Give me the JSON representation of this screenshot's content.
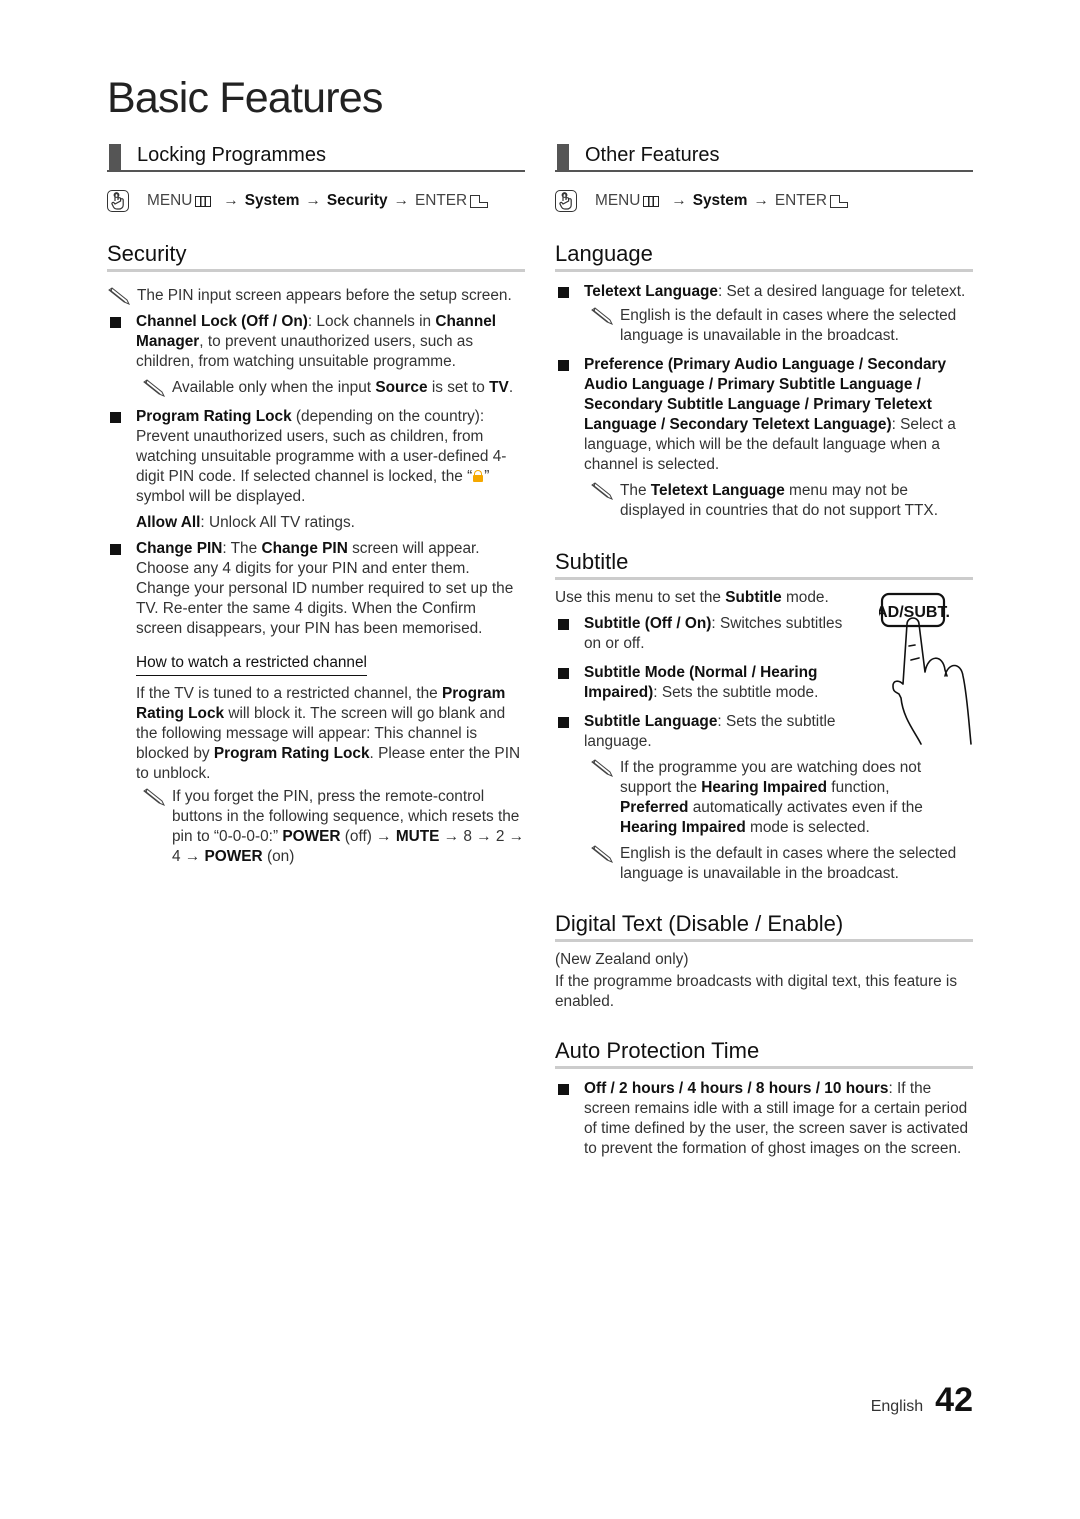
{
  "page_title": "Basic Features",
  "left": {
    "section_title": "Locking Programmes",
    "menu_path": {
      "icon": "menu-hand-icon",
      "menu": "MENU",
      "menu_glyph": "menu-grid-icon",
      "arrow": "→",
      "steps": [
        "System",
        "Security"
      ],
      "enter": "ENTER",
      "enter_glyph": "enter-icon"
    },
    "security": {
      "heading": "Security",
      "intro_note": "The PIN input screen appears before the setup screen.",
      "items": [
        {
          "label": "Channel Lock (Off / On)",
          "text_a": ": Lock channels in ",
          "bold_b": "Channel Manager",
          "text_b": ", to prevent unauthorized users, such as children, from watching unsuitable programme.",
          "note_a": "Available only when the input ",
          "note_bold_a": "Source",
          "note_b": " is set to ",
          "note_bold_b": "TV",
          "note_c": "."
        },
        {
          "label": "Program Rating Lock",
          "text_a": " (depending on the country): Prevent unauthorized users, such as children, from watching unsuitable programme with a user-defined 4-digit PIN code. If selected channel is locked, the “",
          "lock_icon": "lock-icon",
          "text_b": "” symbol will be displayed.",
          "sub_label": "Allow All",
          "sub_text": ": Unlock All TV ratings."
        },
        {
          "label": "Change PIN",
          "text_a": ": The ",
          "bold_b": "Change PIN",
          "text_b": " screen will appear. Choose any 4 digits for your PIN and enter them. Change your personal ID number required to set up the TV. Re-enter the same 4 digits. When the Confirm screen disappears, your PIN has been memorised."
        }
      ],
      "restricted": {
        "heading": "How to watch a restricted channel",
        "p1": "If the TV is tuned to a restricted channel, the ",
        "b1": "Program Rating Lock",
        "p2": " will block it. The screen will go blank and the following message will appear: This channel is blocked by ",
        "b2": "Program Rating Lock",
        "p3": ". Please enter the PIN to unblock.",
        "note_a": "If you forget the PIN, press the remote-control buttons in the following sequence, which resets the pin to “0-0-0-0:” ",
        "note_b1": "POWER",
        "note_b": " (off) → ",
        "note_b2": "MUTE",
        "note_c": " → 8 → 2 → 4 → ",
        "note_b3": "POWER",
        "note_d": " (on)"
      }
    }
  },
  "right": {
    "section_title": "Other Features",
    "menu_path": {
      "icon": "menu-hand-icon",
      "menu": "MENU",
      "arrow": "→",
      "steps": [
        "System"
      ],
      "enter": "ENTER"
    },
    "language": {
      "heading": "Language",
      "items": [
        {
          "label": "Teletext Language",
          "text": ": Set a desired language for teletext.",
          "note": "English is the default in cases where the selected language is unavailable in the broadcast."
        },
        {
          "label": "Preference (Primary Audio Language / Secondary Audio Language / Primary Subtitle Language / Secondary Subtitle Language / Primary Teletext Language / Secondary Teletext Language)",
          "text": ": Select a language, which will be the default language when a channel is selected.",
          "note_a": "The ",
          "note_bold": "Teletext Language",
          "note_b": " menu may not be displayed in countries that do not support TTX."
        }
      ]
    },
    "subtitle": {
      "heading": "Subtitle",
      "intro_a": "Use this menu to set the ",
      "intro_bold": "Subtitle",
      "intro_b": " mode.",
      "button_label": "AD/SUBT.",
      "items": [
        {
          "label": "Subtitle (Off / On)",
          "text": ": Switches subtitles on or off."
        },
        {
          "label": "Subtitle Mode (Normal / Hearing Impaired)",
          "text": ": Sets the subtitle mode."
        },
        {
          "label": "Subtitle Language",
          "text": ": Sets the subtitle language."
        }
      ],
      "note1": {
        "a": "If the programme you are watching does not support the ",
        "b1": "Hearing Impaired",
        "b": " function, ",
        "b2": "Preferred",
        "c": " automatically activates even if the ",
        "b3": "Hearing Impaired",
        "d": " mode is selected."
      },
      "note2": "English is the default in cases where the selected language is unavailable in the broadcast."
    },
    "digital_text": {
      "heading": "Digital Text (Disable / Enable)",
      "p1": "(New Zealand only)",
      "p2": "If the programme broadcasts with digital text, this feature is enabled."
    },
    "auto_protection": {
      "heading": "Auto Protection Time",
      "label": "Off / 2 hours / 4 hours / 8 hours / 10 hours",
      "text": ": If the screen remains idle with a still image for a certain period of time defined by the user, the screen saver is activated to prevent the formation of ghost images on the screen."
    }
  },
  "footer": {
    "language": "English",
    "page_number": "42"
  },
  "colors": {
    "lock_icon": "#f5a800",
    "section_bar": "#555555",
    "heading_rule": "#cccccc"
  }
}
